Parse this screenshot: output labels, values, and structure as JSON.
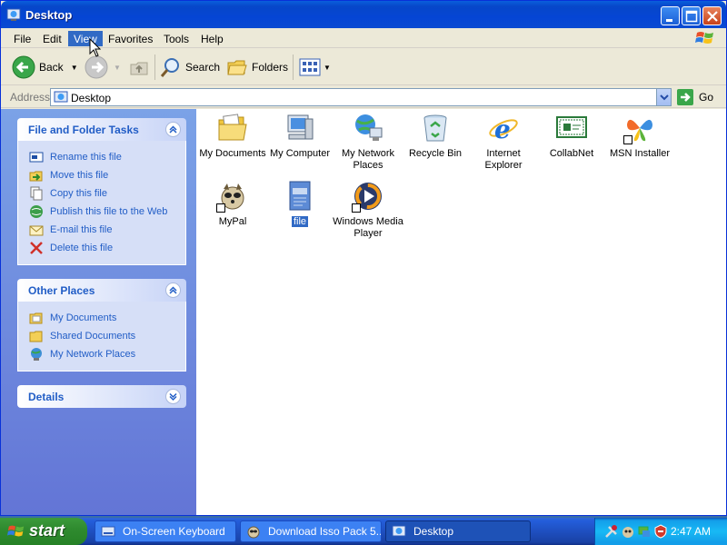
{
  "window": {
    "title": "Desktop",
    "buttons": [
      "minimize",
      "maximize",
      "close"
    ]
  },
  "menubar": {
    "items": [
      "File",
      "Edit",
      "View",
      "Favorites",
      "Tools",
      "Help"
    ],
    "active": "View"
  },
  "toolbar": {
    "back": "Back",
    "search": "Search",
    "folders": "Folders"
  },
  "address": {
    "label": "Address",
    "value": "Desktop",
    "go": "Go"
  },
  "sidebar": {
    "file_tasks": {
      "title": "File and Folder Tasks",
      "items": [
        {
          "label": "Rename this file",
          "icon": "rename-icon"
        },
        {
          "label": "Move this file",
          "icon": "move-icon"
        },
        {
          "label": "Copy this file",
          "icon": "copy-icon"
        },
        {
          "label": "Publish this file to the Web",
          "icon": "publish-icon"
        },
        {
          "label": "E-mail this file",
          "icon": "email-icon"
        },
        {
          "label": "Delete this file",
          "icon": "delete-icon"
        }
      ]
    },
    "other_places": {
      "title": "Other Places",
      "items": [
        {
          "label": "My Documents",
          "icon": "folder-icon"
        },
        {
          "label": "Shared Documents",
          "icon": "folder-icon"
        },
        {
          "label": "My Network Places",
          "icon": "network-icon"
        }
      ]
    },
    "details": {
      "title": "Details"
    }
  },
  "desktop_items": [
    {
      "label": "My Documents",
      "icon": "my-documents-icon"
    },
    {
      "label": "My Computer",
      "icon": "my-computer-icon"
    },
    {
      "label": "My Network Places",
      "icon": "network-places-icon"
    },
    {
      "label": "Recycle Bin",
      "icon": "recycle-bin-icon"
    },
    {
      "label": "Internet Explorer",
      "icon": "internet-explorer-icon"
    },
    {
      "label": "CollabNet",
      "icon": "collabnet-icon"
    },
    {
      "label": "MSN Installer",
      "icon": "msn-icon"
    },
    {
      "label": "MyPal",
      "icon": "mypal-icon"
    },
    {
      "label": "file",
      "icon": "file-icon",
      "selected": true
    },
    {
      "label": "Windows Media Player",
      "icon": "media-player-icon"
    }
  ],
  "taskbar": {
    "start": "start",
    "buttons": [
      {
        "label": "On-Screen Keyboard",
        "icon": "keyboard-icon"
      },
      {
        "label": "Download Isso Pack 5...",
        "icon": "download-icon"
      },
      {
        "label": "Desktop",
        "icon": "desktop-icon",
        "active": true
      }
    ],
    "clock": "2:47 AM"
  }
}
